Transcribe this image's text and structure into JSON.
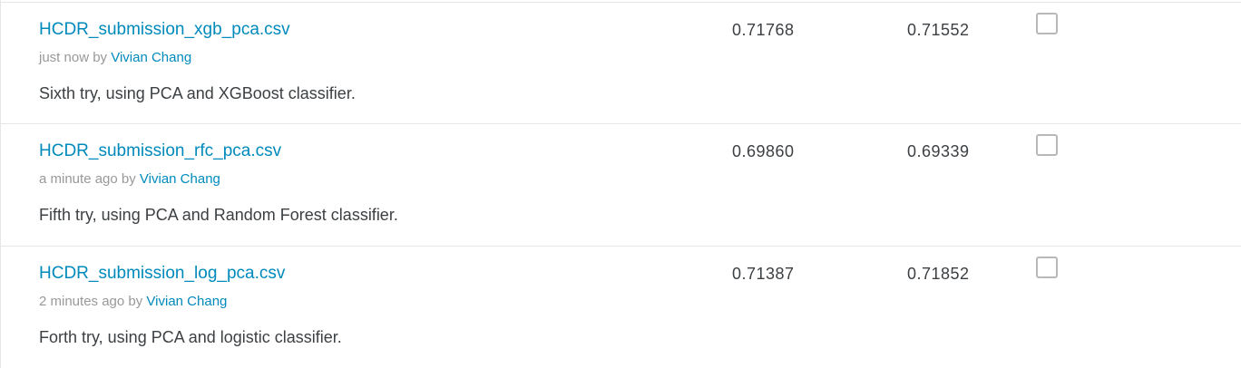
{
  "submissions": [
    {
      "filename": "HCDR_submission_xgb_pca.csv",
      "time": "just now by",
      "author": "Vivian Chang",
      "description": "Sixth try, using PCA and XGBoost classifier.",
      "private_score": "0.71768",
      "public_score": "0.71552",
      "selected": false
    },
    {
      "filename": "HCDR_submission_rfc_pca.csv",
      "time": "a minute ago by",
      "author": "Vivian Chang",
      "description": "Fifth try, using PCA and Random Forest classifier.",
      "private_score": "0.69860",
      "public_score": "0.69339",
      "selected": false
    },
    {
      "filename": "HCDR_submission_log_pca.csv",
      "time": "2 minutes ago by",
      "author": "Vivian Chang",
      "description": "Forth try, using PCA and logistic classifier.",
      "private_score": "0.71387",
      "public_score": "0.71852",
      "selected": false
    }
  ],
  "colors": {
    "link": "#008abc",
    "muted": "#999999",
    "text": "#3c4043",
    "border": "#e6e6e6"
  }
}
